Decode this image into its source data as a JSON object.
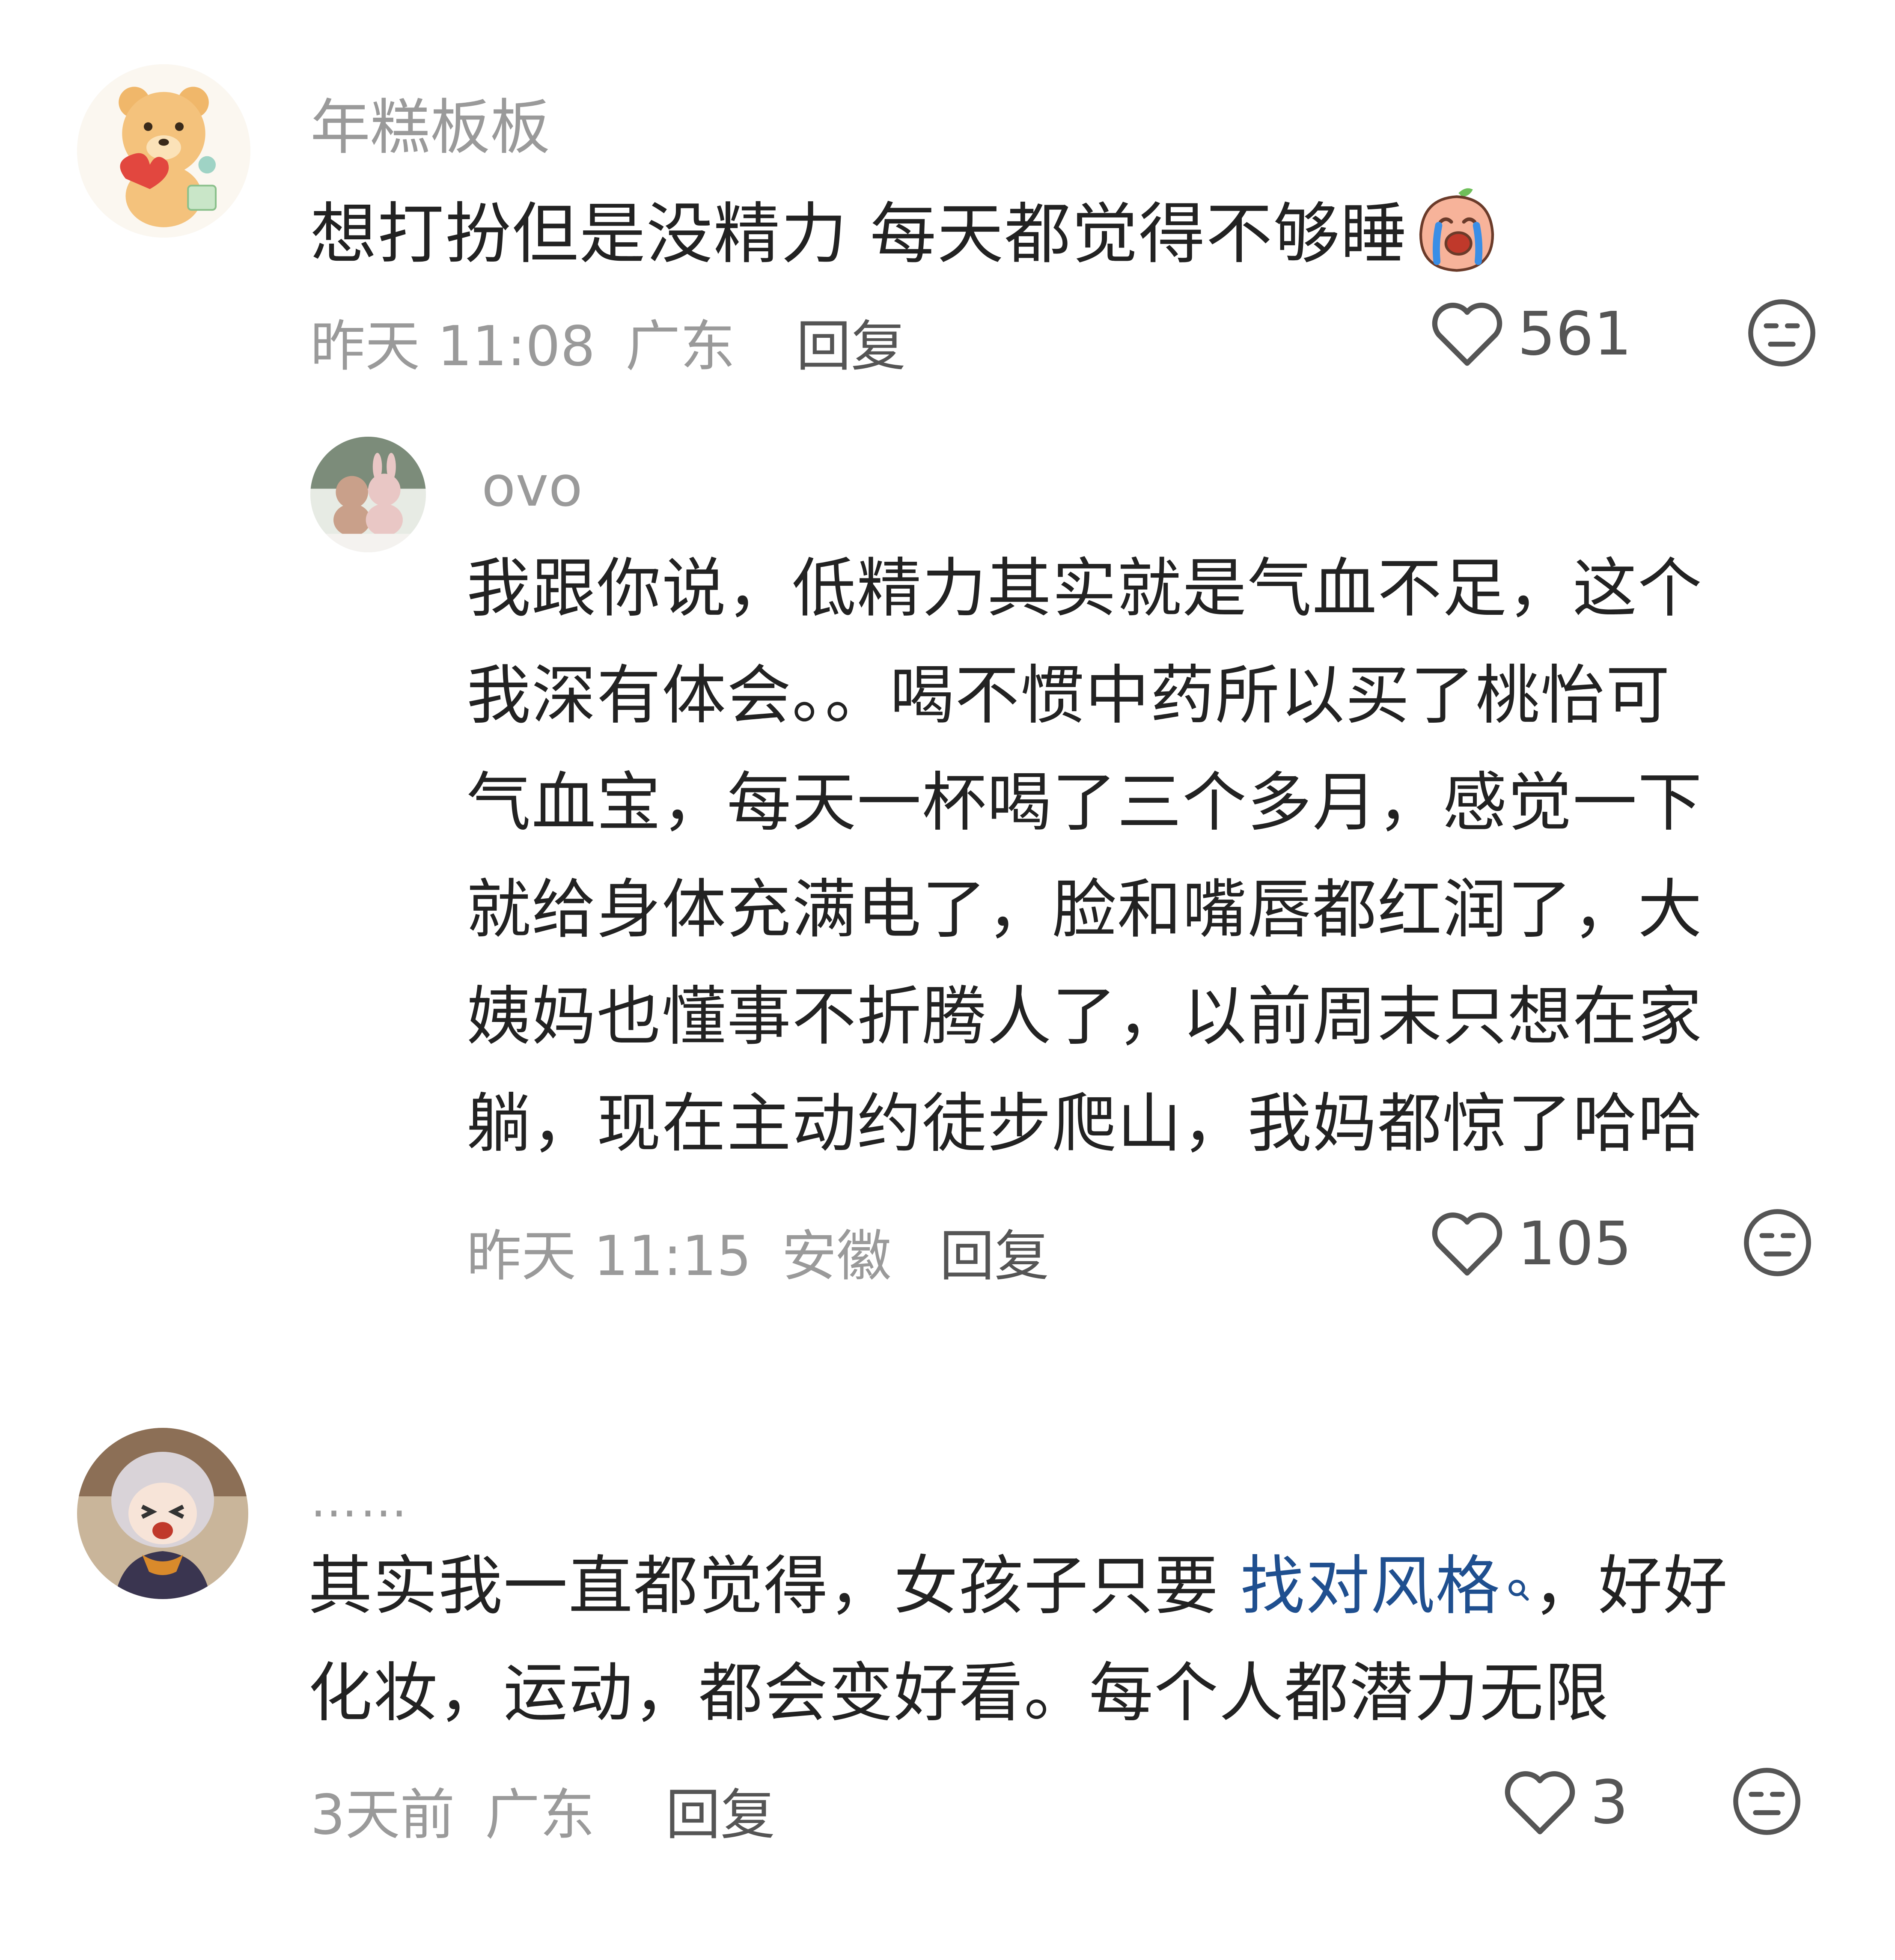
{
  "comments": [
    {
      "username": "年糕板板",
      "content": "想打扮但是没精力 每天都觉得不够睡",
      "emoji": "crying-peach-emoji",
      "time": "昨天 11:08",
      "location": "广东",
      "reply_label": "回复",
      "likes": "561"
    },
    {
      "username": "ovo",
      "content_lines": [
        "我跟你说，低精力其实就是气血不足，这个",
        "我深有体会。。喝不惯中药所以买了桃怡可",
        "气血宝，每天一杯喝了三个多月，感觉一下",
        "就给身体充满电了，脸和嘴唇都红润了，大",
        "姨妈也懂事不折腾人了，以前周末只想在家",
        "躺，现在主动约徒步爬山，我妈都惊了哈哈"
      ],
      "time": "昨天 11:15",
      "location": "安徽",
      "reply_label": "回复",
      "likes": "105"
    },
    {
      "username": "……",
      "line1_before": "其实我一直都觉得，女孩子只要 ",
      "line1_link": "找对风格",
      "line1_after": "，好好",
      "line2": "化妆，运动，都会变好看。每个人都潜力无限",
      "time": "3天前",
      "location": "广东",
      "reply_label": "回复",
      "likes": "3"
    }
  ],
  "colors": {
    "text": "#222222",
    "meta": "#9a9a9a",
    "link": "#1f4f8f"
  }
}
